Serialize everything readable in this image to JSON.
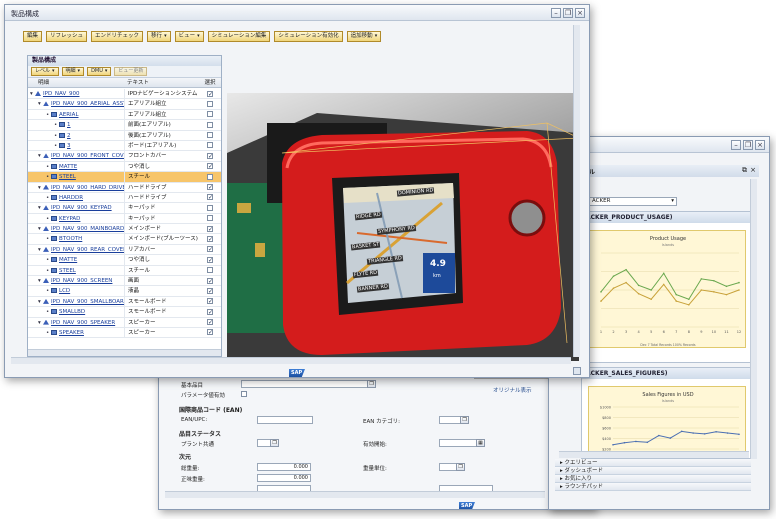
{
  "main_window": {
    "title": "製品構成",
    "toolbar": [
      {
        "label": "編集",
        "dropdown": false
      },
      {
        "label": "リフレッシュ",
        "dropdown": false
      },
      {
        "label": "エンドリチェック",
        "dropdown": false
      },
      {
        "label": "移行",
        "dropdown": true
      },
      {
        "label": "ビュー",
        "dropdown": true
      },
      {
        "label": "シミュレーション編集",
        "dropdown": false
      },
      {
        "label": "シミュレーション有効化",
        "dropdown": false
      },
      {
        "label": "追加移動",
        "dropdown": true
      }
    ],
    "tree": {
      "title": "製品構成",
      "tools": [
        {
          "label": "レベル",
          "dropdown": true
        },
        {
          "label": "明細",
          "dropdown": true
        },
        {
          "label": "DMU",
          "dropdown": true
        },
        {
          "label": "ビュー更新",
          "dropdown": false
        }
      ],
      "columns": [
        "明細",
        "テキスト",
        "選択"
      ],
      "rows": [
        {
          "item": "IPD_NAV_900",
          "text": "IPDナビゲーションシステム",
          "checked": true,
          "indent": 0,
          "icon": "assembly-icon"
        },
        {
          "item": "IPD_NAV_900_AERIAL_ASSY",
          "text": "エアリアル組立",
          "checked": false,
          "indent": 1,
          "icon": "assembly-icon"
        },
        {
          "item": "AERIAL",
          "text": "エアリアル組立",
          "checked": false,
          "indent": 2,
          "icon": "part-icon"
        },
        {
          "item": "1",
          "text": "前面(エアリアル)",
          "checked": false,
          "indent": 3,
          "icon": "part-icon"
        },
        {
          "item": "2",
          "text": "後面(エアリアル)",
          "checked": false,
          "indent": 3,
          "icon": "part-icon"
        },
        {
          "item": "3",
          "text": "ボード(エアリアル)",
          "checked": false,
          "indent": 3,
          "icon": "part-icon"
        },
        {
          "item": "IPD_NAV_900_FRONT_COVER",
          "text": "フロントカバー",
          "checked": true,
          "indent": 1,
          "icon": "assembly-icon"
        },
        {
          "item": "MATTE",
          "text": "つや消し",
          "checked": true,
          "indent": 2,
          "icon": "part-icon"
        },
        {
          "item": "STEEL",
          "text": "スチール",
          "checked": false,
          "indent": 2,
          "icon": "part-icon",
          "selected": true
        },
        {
          "item": "IPD_NAV_900_HARD_DRIVE",
          "text": "ハードドライブ",
          "checked": true,
          "indent": 1,
          "icon": "assembly-icon"
        },
        {
          "item": "HARDDR",
          "text": "ハードドライブ",
          "checked": true,
          "indent": 2,
          "icon": "part-icon"
        },
        {
          "item": "IPD_NAV_900_KEYPAD",
          "text": "キーパッド",
          "checked": false,
          "indent": 1,
          "icon": "assembly-icon"
        },
        {
          "item": "KEYPAD",
          "text": "キーパッド",
          "checked": false,
          "indent": 2,
          "icon": "part-icon"
        },
        {
          "item": "IPD_NAV_900_MAINBOARD",
          "text": "メインボード",
          "checked": true,
          "indent": 1,
          "icon": "assembly-icon"
        },
        {
          "item": "BTOOTH",
          "text": "メインボード(ブルーツース)",
          "checked": true,
          "indent": 2,
          "icon": "part-icon"
        },
        {
          "item": "IPD_NAV_900_REAR_COVER",
          "text": "リアカバー",
          "checked": true,
          "indent": 1,
          "icon": "assembly-icon"
        },
        {
          "item": "MATTE",
          "text": "つや消し",
          "checked": true,
          "indent": 2,
          "icon": "part-icon"
        },
        {
          "item": "STEEL",
          "text": "スチール",
          "checked": false,
          "indent": 2,
          "icon": "part-icon"
        },
        {
          "item": "IPD_NAV_900_SCREEN",
          "text": "画面",
          "checked": true,
          "indent": 1,
          "icon": "assembly-icon"
        },
        {
          "item": "LCD",
          "text": "液晶",
          "checked": true,
          "indent": 2,
          "icon": "part-icon"
        },
        {
          "item": "IPD_NAV_900_SMALLBOARD",
          "text": "スモールボード",
          "checked": true,
          "indent": 1,
          "icon": "assembly-icon"
        },
        {
          "item": "SMALLBD",
          "text": "スモールボード",
          "checked": true,
          "indent": 2,
          "icon": "part-icon"
        },
        {
          "item": "IPD_NAV_900_SPEAKER",
          "text": "スピーカー",
          "checked": true,
          "indent": 1,
          "icon": "assembly-icon"
        },
        {
          "item": "SPEAKER",
          "text": "スピーカー",
          "checked": true,
          "indent": 2,
          "icon": "part-icon"
        }
      ]
    },
    "viewer": {
      "screen_texts": [
        "DOMINION RD",
        "RIDGE RD",
        "SYMPHONY RD",
        "BASKET ST",
        "TRIANGLE RD",
        "FLYTE RD",
        "BANNER RD"
      ],
      "speed_value": "4.9",
      "speed_unit": "km"
    }
  },
  "report_window": {
    "header_text": "ル",
    "dropdown_value": "ACKER",
    "section1": "ACKER_PRODUCT_USAGE)",
    "section2": "ACKER_SALES_FIGURES)",
    "accordion": [
      "クエリビュー",
      "ダッシュボード",
      "お気に入り",
      "ラウンチパッド"
    ]
  },
  "form_window": {
    "preview_label": "オリジナル表示",
    "fields": {
      "basic_product": "基本品目",
      "param_valid": "パラメータ値有効",
      "ean_header": "国際商品コード (EAN)",
      "ean_upc": "EAN/UPC:",
      "ean_category": "EAN カテゴリ:",
      "item_status_header": "品目ステータス",
      "plant_common": "プラント共通",
      "valid_from": "有効開始:",
      "dims_header": "次元",
      "gross_weight": "総重量:",
      "gross_value": "0.000",
      "weight_unit": "重量単位:",
      "net_weight": "正味重量:",
      "net_value": "0.000"
    }
  },
  "chart_data": [
    {
      "type": "line",
      "title": "Product Usage",
      "subtitle": "Islands",
      "categories": [
        "1",
        "2",
        "3",
        "4",
        "5",
        "6",
        "7",
        "8",
        "9",
        "10",
        "11",
        "12"
      ],
      "series": [
        {
          "name": "",
          "values": [
            38,
            55,
            62,
            45,
            40,
            58,
            35,
            30,
            52,
            50,
            44,
            48
          ],
          "color": "#6aa84f"
        },
        {
          "name": "",
          "values": [
            28,
            42,
            48,
            36,
            30,
            46,
            28,
            24,
            40,
            38,
            35,
            40
          ],
          "color": "#c8a23a"
        }
      ],
      "footer": "Dec 7 Total Records  100% Records",
      "ylim": [
        0,
        80
      ],
      "grid": true
    },
    {
      "type": "line",
      "title": "Sales Figures in USD",
      "subtitle": "Islands",
      "categories": [
        "1",
        "2",
        "3",
        "4",
        "5",
        "6",
        "7",
        "8",
        "9",
        "10",
        "11",
        "12"
      ],
      "series": [
        {
          "name": "",
          "values": [
            100,
            150,
            180,
            160,
            320,
            260,
            420,
            380,
            360,
            410,
            380,
            350
          ],
          "color": "#4a6fb3"
        }
      ],
      "yticks": [
        "$1000",
        "$800",
        "$600",
        "$400",
        "$200"
      ],
      "ylim": [
        0,
        1000
      ],
      "grid": true
    }
  ]
}
